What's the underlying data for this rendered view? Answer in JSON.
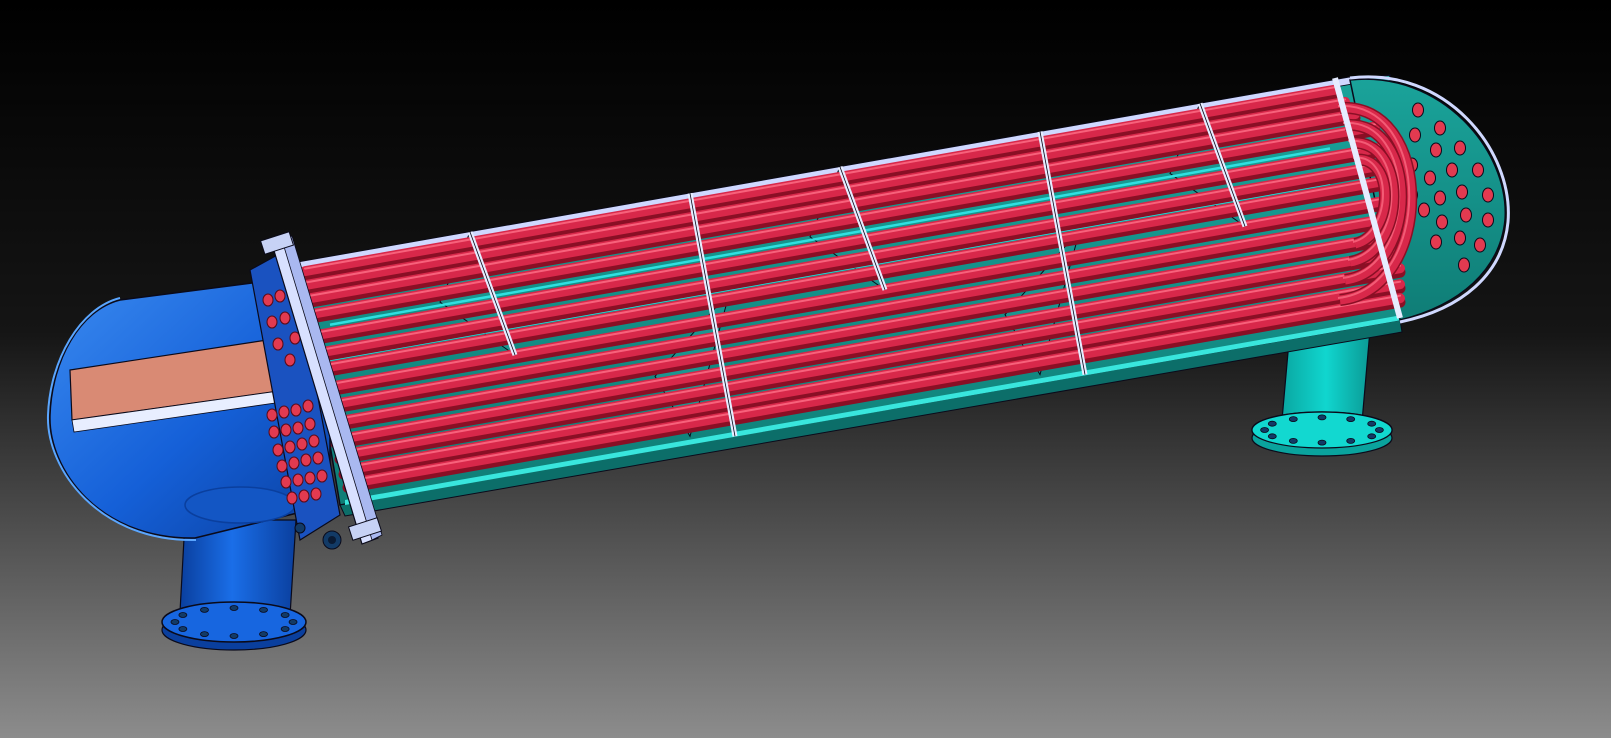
{
  "viewport": {
    "background_top": "#000000",
    "background_bottom": "#8c8c8c"
  },
  "colors": {
    "channel_head": "#1560d8",
    "channel_head_dark": "#0a3f9e",
    "channel_head_light": "#3a8af0",
    "pass_partition": "#d98a74",
    "tubesheet": "#1a52c0",
    "tube_hole": "#e23a50",
    "shell_inner": "#1aa39a",
    "shell_inner_dark": "#0f7d76",
    "shell_rim": "#39e6dd",
    "shell_cut_edge": "#cfd8ff",
    "baffle": "#1b9690",
    "baffle_edge": "#e6ecff",
    "tie_rod": "#2fe0e0",
    "tube": "#d8284a",
    "tube_highlight": "#ff7088",
    "tube_shadow": "#8a0f25",
    "nozzle_shell": "#10d6cf",
    "nozzle_channel": "#1a6ee8",
    "flange_bolt": "#123a66",
    "outline": "#0a0a1a"
  },
  "parts": [
    "channel-head",
    "pass-partition-plate",
    "tubesheet",
    "tubesheet-flange",
    "shell",
    "segmental-baffles",
    "tie-rods",
    "u-tube-bundle",
    "u-bend-returns",
    "shell-cover",
    "shell-nozzle",
    "channel-nozzle",
    "nozzle-flanges"
  ]
}
